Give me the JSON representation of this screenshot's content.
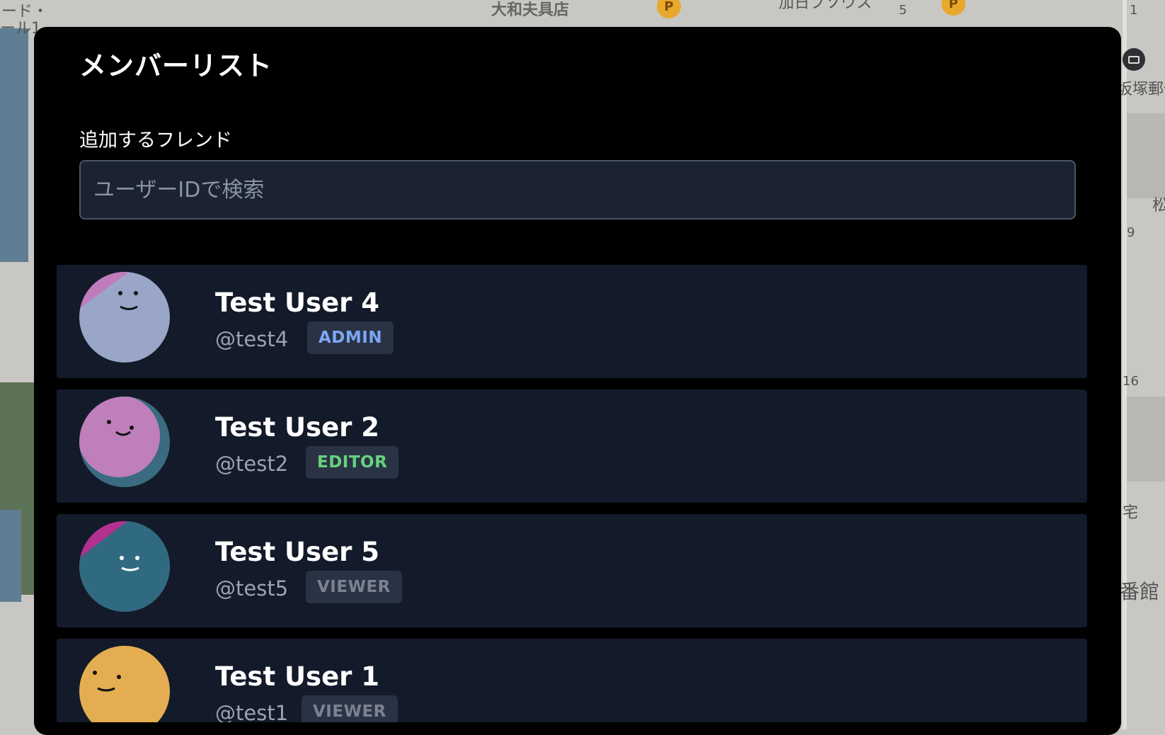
{
  "map": {
    "labels": [
      "ード・",
      "ール1",
      "大和夫具店",
      "加日ブソウス",
      "坂塚郵便",
      "松",
      "宅",
      "番館",
      "5",
      "1",
      "9",
      "16"
    ],
    "pin_label": "P",
    "icons": [
      "parking-icon",
      "mail-icon"
    ]
  },
  "modal": {
    "title": "メンバーリスト",
    "friend_field_label": "追加するフレンド",
    "search_placeholder": "ユーザーIDで検索",
    "search_value": ""
  },
  "members": [
    {
      "name": "Test User 4",
      "handle": "@test4",
      "role": "ADMIN",
      "role_color": "#7aa7f5",
      "avatar_colors": [
        "#9aa6c8",
        "#c07bbd"
      ]
    },
    {
      "name": "Test User 2",
      "handle": "@test2",
      "role": "EDITOR",
      "role_color": "#66d27e",
      "avatar_colors": [
        "#bf7fba",
        "#3a6b80"
      ]
    },
    {
      "name": "Test User 5",
      "handle": "@test5",
      "role": "VIEWER",
      "role_color": "#7b8291",
      "avatar_colors": [
        "#2f6a80",
        "#b2318f"
      ]
    },
    {
      "name": "Test User 1",
      "handle": "@test1",
      "role": "VIEWER",
      "role_color": "#7b8291",
      "avatar_colors": [
        "#e5ad52",
        "#e5ad52"
      ]
    }
  ],
  "colors": {
    "modal_bg": "#000000",
    "row_bg": "#131a29",
    "input_bg": "#1b2331",
    "badge_bg": "#2a3344"
  }
}
